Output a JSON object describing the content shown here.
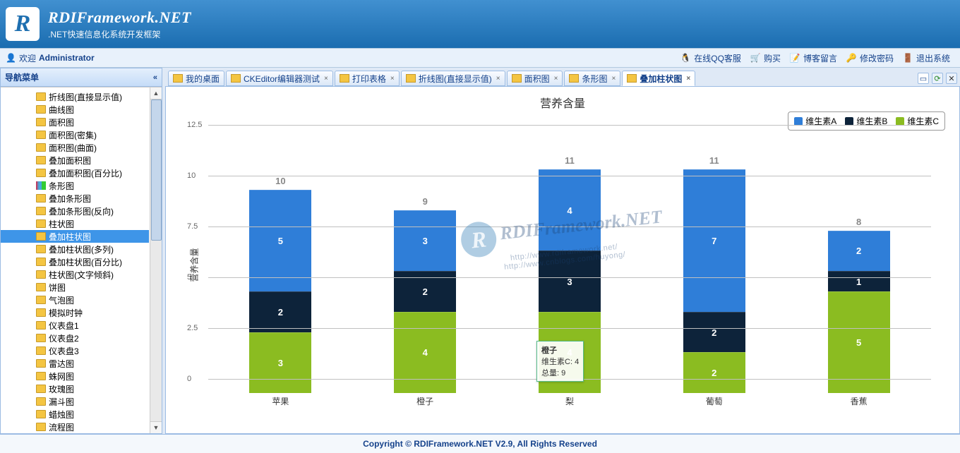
{
  "brand": {
    "title": "RDIFramework.NET",
    "sub": ".NET快速信息化系统开发框架"
  },
  "welcome": {
    "label": "欢迎",
    "user": "Administrator"
  },
  "toolbar": {
    "qq": "在线QQ客服",
    "buy": "购买",
    "blog": "博客留言",
    "pwd": "修改密码",
    "exit": "退出系统"
  },
  "sidebar": {
    "title": "导航菜单",
    "items": [
      "折线图(直接显示值)",
      "曲线图",
      "面积图",
      "面积图(密集)",
      "面积图(曲面)",
      "叠加面积图",
      "叠加面积图(百分比)",
      "条形图",
      "叠加条形图",
      "叠加条形图(反向)",
      "柱状图",
      "叠加柱状图",
      "叠加柱状图(多列)",
      "叠加柱状图(百分比)",
      "柱状图(文字倾斜)",
      "饼图",
      "气泡图",
      "模拟时钟",
      "仪表盘1",
      "仪表盘2",
      "仪表盘3",
      "雷达图",
      "蛛网图",
      "玫瑰图",
      "漏斗图",
      "蜡烛图",
      "流程图"
    ],
    "selectedIndex": 11,
    "barIconIndex": 7
  },
  "tabs": {
    "items": [
      {
        "label": "我的桌面",
        "closable": false
      },
      {
        "label": "CKEditor编辑器测试",
        "closable": true
      },
      {
        "label": "打印表格",
        "closable": true
      },
      {
        "label": "折线图(直接显示值)",
        "closable": true
      },
      {
        "label": "面积图",
        "closable": true
      },
      {
        "label": "条形图",
        "closable": true
      },
      {
        "label": "叠加柱状图",
        "closable": true
      }
    ],
    "activeIndex": 6
  },
  "chart_data": {
    "type": "bar",
    "stacked": true,
    "title": "营养含量",
    "ylabel": "营养含量",
    "ylim": [
      0,
      12.5
    ],
    "yticks": [
      0,
      2.5,
      5,
      7.5,
      10,
      12.5
    ],
    "categories": [
      "苹果",
      "橙子",
      "梨",
      "葡萄",
      "香蕉"
    ],
    "series": [
      {
        "name": "维生素A",
        "color": "#2f7ed8",
        "values": [
          5,
          3,
          4,
          7,
          2
        ]
      },
      {
        "name": "维生素B",
        "color": "#0d233a",
        "values": [
          2,
          2,
          3,
          2,
          1
        ]
      },
      {
        "name": "维生素C",
        "color": "#8bbc21",
        "values": [
          3,
          4,
          4,
          2,
          5
        ]
      }
    ],
    "totals": [
      10,
      9,
      11,
      11,
      8
    ]
  },
  "tooltip": {
    "cat": "橙子",
    "series": "维生素C",
    "val": "4",
    "sumlabel": "总量",
    "sum": "9"
  },
  "watermark": {
    "main": "RDIFramework.NET",
    "u1": "http://www.rdiframework.net/",
    "u2": "http://www.cnblogs.com/huyong/"
  },
  "footer": "Copyright © RDIFramework.NET V2.9, All Rights Reserved"
}
